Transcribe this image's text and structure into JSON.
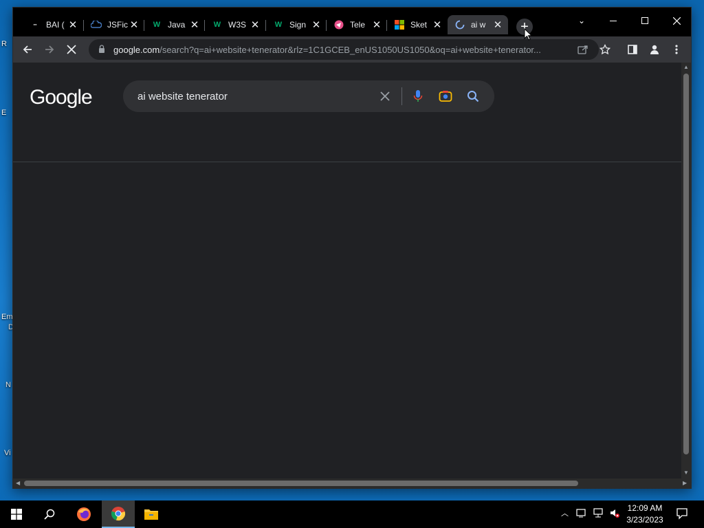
{
  "desktop": {
    "icon_labels": [
      "R",
      "E",
      "Em",
      "D",
      "N",
      "Vi"
    ]
  },
  "browser": {
    "tabs": [
      {
        "title": "BAI (",
        "icon": "brand-icon",
        "active": false
      },
      {
        "title": "JSFic",
        "icon": "jsfiddle-icon",
        "active": false
      },
      {
        "title": "Java",
        "icon": "w3schools-icon",
        "active": false
      },
      {
        "title": "W3S",
        "icon": "w3schools-icon",
        "active": false
      },
      {
        "title": "Sign",
        "icon": "w3schools-icon",
        "active": false
      },
      {
        "title": "Tele",
        "icon": "telegram-icon",
        "active": false
      },
      {
        "title": "Sket",
        "icon": "microsoft-icon",
        "active": false
      },
      {
        "title": "ai w",
        "icon": "loading-spinner-icon",
        "active": true
      }
    ],
    "new_tab_label": "+",
    "url_host": "google.com",
    "url_path": "/search?q=ai+website+tenerator&rlz=1C1GCEB_enUS1050US1050&oq=ai+website+tenerator..."
  },
  "google": {
    "logo": "Google",
    "query": "ai website tenerator"
  },
  "taskbar": {
    "time": "12:09 AM",
    "date": "3/23/2023"
  },
  "colors": {
    "page_bg": "#202124",
    "search_bg": "#303134",
    "tab_active": "#35363a",
    "accent": "#8ab4f8"
  }
}
